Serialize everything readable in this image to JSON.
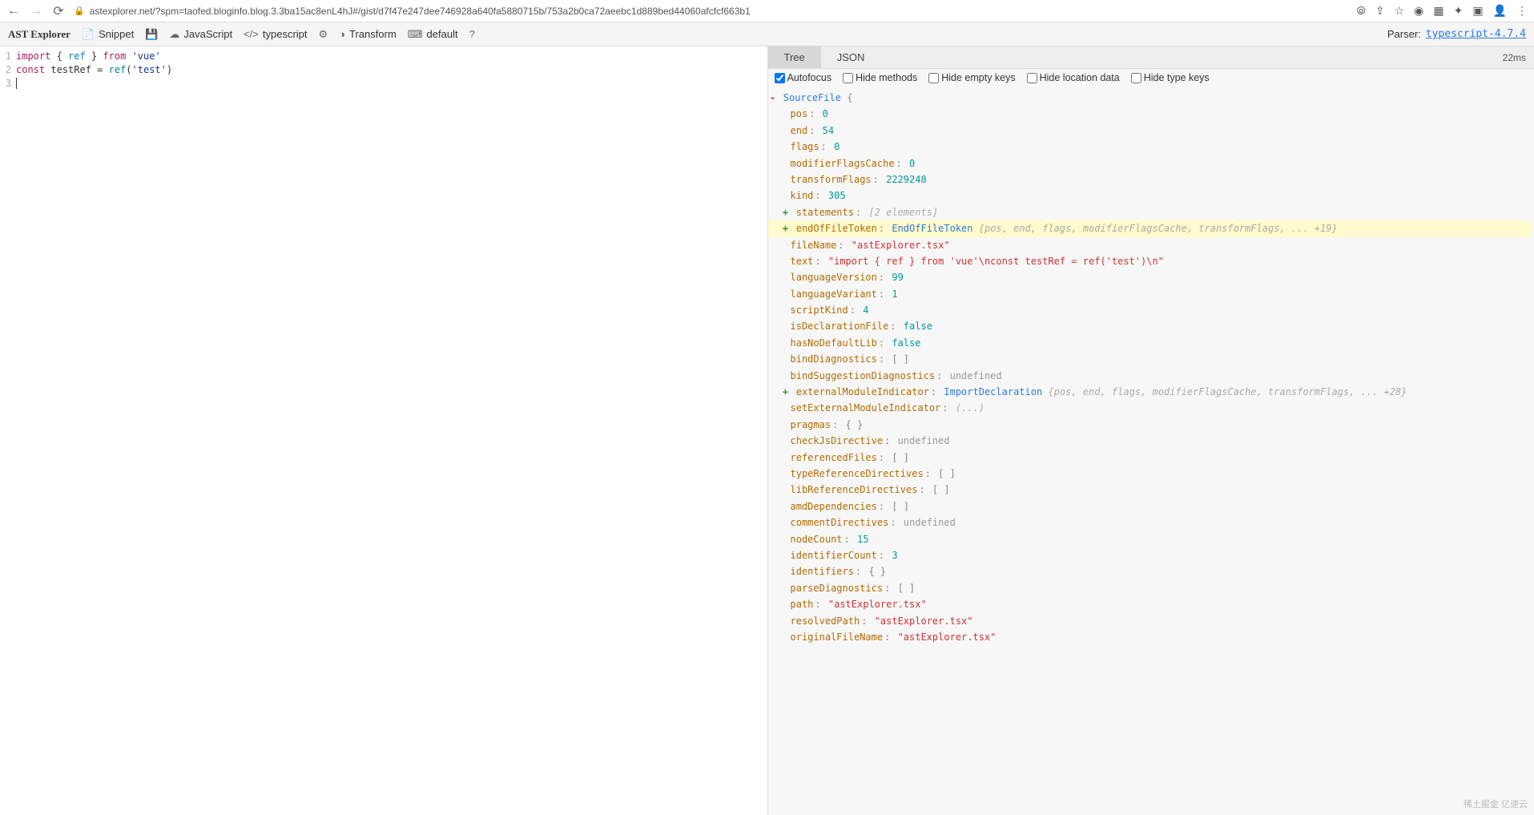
{
  "browser": {
    "url": "astexplorer.net/?spm=taofed.bloginfo.blog.3.3ba15ac8enL4hJ#/gist/d7f47e247dee746928a640fa5880715b/753a2b0ca72aeebc1d889bed44060afcfcf663b1"
  },
  "toolbar": {
    "title": "AST Explorer",
    "snippet": "Snippet",
    "language": "JavaScript",
    "parser": "typescript",
    "transform": "Transform",
    "default": "default",
    "parser_label": "Parser:",
    "parser_version": "typescript-4.7.4"
  },
  "code": {
    "lines": [
      {
        "n": "1",
        "html": "<span class='kw'>import</span> { <span class='fn'>ref</span> } <span class='kw'>from</span> <span class='str'>'vue'</span>"
      },
      {
        "n": "2",
        "html": "<span class='kw'>const</span> testRef = <span class='fn'>ref</span>(<span class='str'>'test'</span>)"
      },
      {
        "n": "3",
        "html": "<span class='cursor'></span>"
      }
    ]
  },
  "tabs": {
    "tree": "Tree",
    "json": "JSON",
    "timing": "22ms"
  },
  "options": {
    "autofocus": "Autofocus",
    "hide_methods": "Hide methods",
    "hide_empty_keys": "Hide empty keys",
    "hide_location": "Hide location data",
    "hide_type_keys": "Hide type keys"
  },
  "ast": {
    "root": "SourceFile",
    "props": [
      {
        "k": "pos",
        "v": "0",
        "t": "num"
      },
      {
        "k": "end",
        "v": "54",
        "t": "num"
      },
      {
        "k": "flags",
        "v": "0",
        "t": "num"
      },
      {
        "k": "modifierFlagsCache",
        "v": "0",
        "t": "num"
      },
      {
        "k": "transformFlags",
        "v": "2229248",
        "t": "num"
      },
      {
        "k": "kind",
        "v": "305",
        "t": "num"
      },
      {
        "k": "statements",
        "t": "expand",
        "preview": "[2 elements]"
      },
      {
        "k": "endOfFileToken",
        "t": "expand-type",
        "type": "EndOfFileToken",
        "preview": "{pos, end, flags, modifierFlagsCache, transformFlags, ... +19}",
        "hl": true
      },
      {
        "k": "fileName",
        "v": "\"astExplorer.tsx\"",
        "t": "str"
      },
      {
        "k": "text",
        "v": "\"import { ref } from 'vue'\\nconst testRef = ref('test')\\n\"",
        "t": "str"
      },
      {
        "k": "languageVersion",
        "v": "99",
        "t": "num"
      },
      {
        "k": "languageVariant",
        "v": "1",
        "t": "num"
      },
      {
        "k": "scriptKind",
        "v": "4",
        "t": "num"
      },
      {
        "k": "isDeclarationFile",
        "v": "false",
        "t": "bool"
      },
      {
        "k": "hasNoDefaultLib",
        "v": "false",
        "t": "bool"
      },
      {
        "k": "bindDiagnostics",
        "v": "[ ]",
        "t": "raw"
      },
      {
        "k": "bindSuggestionDiagnostics",
        "v": "undefined",
        "t": "undef"
      },
      {
        "k": "externalModuleIndicator",
        "t": "expand-type",
        "type": "ImportDeclaration",
        "preview": "{pos, end, flags, modifierFlagsCache, transformFlags, ... +28}"
      },
      {
        "k": "setExternalModuleIndicator",
        "v": "(...)",
        "t": "raw-italic"
      },
      {
        "k": "pragmas",
        "v": "{ }",
        "t": "raw"
      },
      {
        "k": "checkJsDirective",
        "v": "undefined",
        "t": "undef"
      },
      {
        "k": "referencedFiles",
        "v": "[ ]",
        "t": "raw"
      },
      {
        "k": "typeReferenceDirectives",
        "v": "[ ]",
        "t": "raw"
      },
      {
        "k": "libReferenceDirectives",
        "v": "[ ]",
        "t": "raw"
      },
      {
        "k": "amdDependencies",
        "v": "[ ]",
        "t": "raw"
      },
      {
        "k": "commentDirectives",
        "v": "undefined",
        "t": "undef"
      },
      {
        "k": "nodeCount",
        "v": "15",
        "t": "num"
      },
      {
        "k": "identifierCount",
        "v": "3",
        "t": "num"
      },
      {
        "k": "identifiers",
        "v": "{ }",
        "t": "raw"
      },
      {
        "k": "parseDiagnostics",
        "v": "[ ]",
        "t": "raw"
      },
      {
        "k": "path",
        "v": "\"astExplorer.tsx\"",
        "t": "str"
      },
      {
        "k": "resolvedPath",
        "v": "\"astExplorer.tsx\"",
        "t": "str"
      },
      {
        "k": "originalFileName",
        "v": "\"astExplorer.tsx\"",
        "t": "str"
      }
    ]
  },
  "watermark": "稀土掘金  亿速云"
}
